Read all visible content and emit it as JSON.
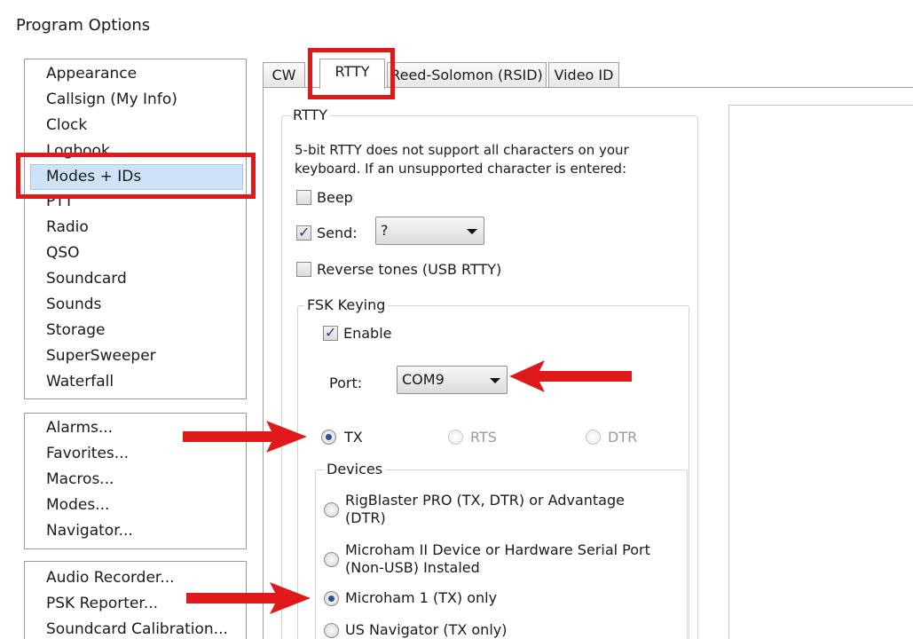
{
  "window": {
    "title": "Program Options"
  },
  "left_panel": {
    "categories": [
      "Appearance",
      "Callsign (My Info)",
      "Clock",
      "Logbook",
      "Modes + IDs",
      "PTT",
      "Radio",
      "QSO",
      "Soundcard",
      "Sounds",
      "Storage",
      "SuperSweeper",
      "Waterfall"
    ],
    "dialogs": [
      "Alarms...",
      "Favorites...",
      "Macros...",
      "Modes...",
      "Navigator..."
    ],
    "tools": [
      "Audio Recorder...",
      "PSK Reporter...",
      "Soundcard Calibration..."
    ]
  },
  "tabs": [
    "CW",
    "RTTY",
    "Reed-Solomon (RSID)",
    "Video ID"
  ],
  "rtty": {
    "group_label": "RTTY",
    "note_line1": "5-bit RTTY does not support all characters on your",
    "note_line2": "keyboard. If an unsupported character  is entered:",
    "beep_label": "Beep",
    "beep_checked": false,
    "send_label": "Send:",
    "send_checked": true,
    "send_value": "?",
    "reverse_label": "Reverse tones (USB RTTY)",
    "reverse_checked": false
  },
  "fsk": {
    "group_label": "FSK Keying",
    "enable_label": "Enable",
    "enable_checked": true,
    "port_label": "Port:",
    "port_value": "COM9",
    "pins": [
      {
        "label": "TX",
        "selected": true,
        "enabled": true
      },
      {
        "label": "RTS",
        "selected": false,
        "enabled": false
      },
      {
        "label": "DTR",
        "selected": false,
        "enabled": false
      }
    ]
  },
  "devices": {
    "group_label": "Devices",
    "options": [
      {
        "line1": "RigBlaster PRO (TX, DTR) or Advantage",
        "line2": "(DTR)",
        "selected": false
      },
      {
        "line1": "Microham II Device or Hardware Serial Port",
        "line2": "(Non-USB) Instaled",
        "selected": false
      },
      {
        "line1": "Microham 1 (TX) only",
        "line2": "",
        "selected": true
      },
      {
        "line1": "US Navigator (TX only)",
        "line2": "",
        "selected": false
      }
    ]
  },
  "annotation_color": "#e01a1a"
}
